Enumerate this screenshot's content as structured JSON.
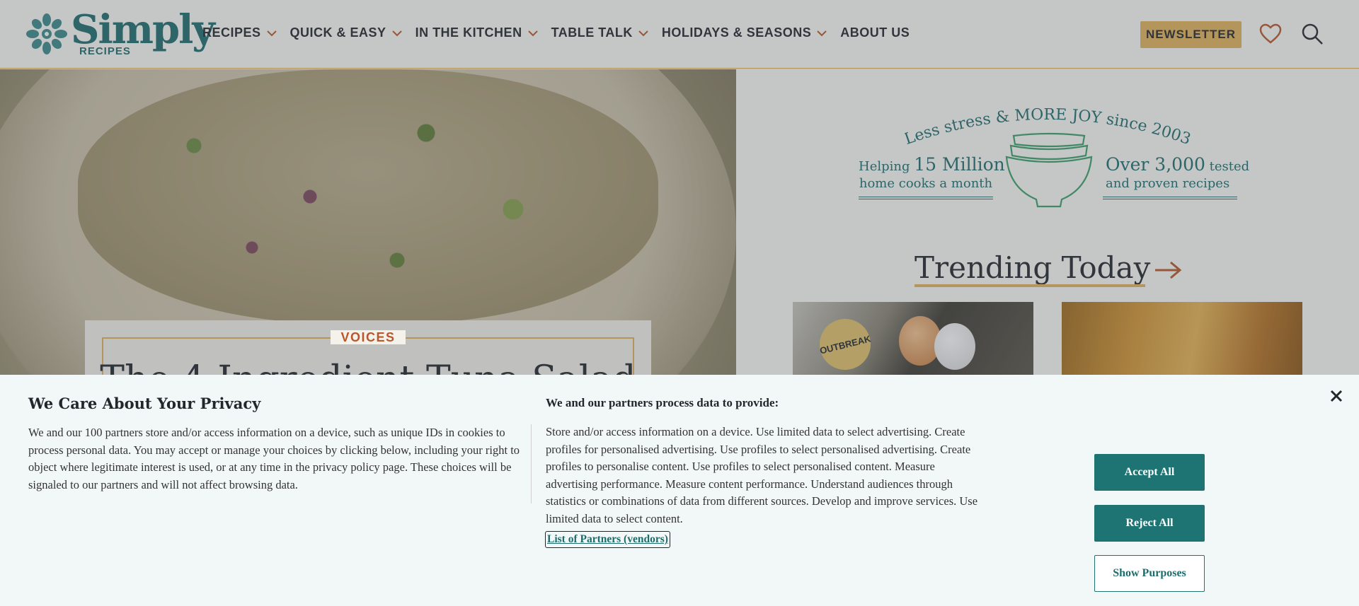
{
  "header": {
    "logo": {
      "word": "Simply",
      "sub": "RECIPES"
    },
    "nav": [
      {
        "label": "RECIPES",
        "has_dropdown": true
      },
      {
        "label": "QUICK & EASY",
        "has_dropdown": true
      },
      {
        "label": "IN THE KITCHEN",
        "has_dropdown": true
      },
      {
        "label": "TABLE TALK",
        "has_dropdown": true
      },
      {
        "label": "HOLIDAYS & SEASONS",
        "has_dropdown": true
      },
      {
        "label": "ABOUT US",
        "has_dropdown": false
      }
    ],
    "newsletter_label": "NEWSLETTER",
    "icons": [
      "heart-icon",
      "search-icon"
    ]
  },
  "hero": {
    "kicker": "VOICES",
    "title": "The 4-Ingredient Tuna Salad"
  },
  "promo": {
    "tagline": "Less stress & MORE JOY since 2003",
    "stat_left": {
      "prefix": "Helping",
      "big": "15 Million",
      "line2": "home cooks a month"
    },
    "stat_right": {
      "big": "Over 3,000",
      "suffix": "tested",
      "line2": "and proven recipes"
    },
    "trending_title": "Trending Today",
    "thumb_badge": "OUTBREAK"
  },
  "consent": {
    "title": "We Care About Your Privacy",
    "body": "We and our 100 partners store and/or access information on a device, such as unique IDs in cookies to process personal data. You may accept or manage your choices by clicking below, including your right to object where legitimate interest is used, or at any time in the privacy policy page. These choices will be signaled to our partners and will not affect browsing data.",
    "purposes_title": "We and our partners process data to provide:",
    "purposes_body": "Store and/or access information on a device. Use limited data to select advertising. Create profiles for personalised advertising. Use profiles to select personalised advertising. Create profiles to personalise content. Use profiles to select personalised content. Measure advertising performance. Measure content performance. Understand audiences through statistics or combinations of data from different sources. Develop and improve services. Use limited data to select content.",
    "partners_link": "List of Partners (vendors)",
    "accept_label": "Accept All",
    "reject_label": "Reject All",
    "purposes_label": "Show Purposes"
  },
  "colors": {
    "brand_teal": "#1e6c6c",
    "accent_gold": "#e4b35b",
    "accent_rust": "#b8582a",
    "button_teal": "#1e7373"
  }
}
